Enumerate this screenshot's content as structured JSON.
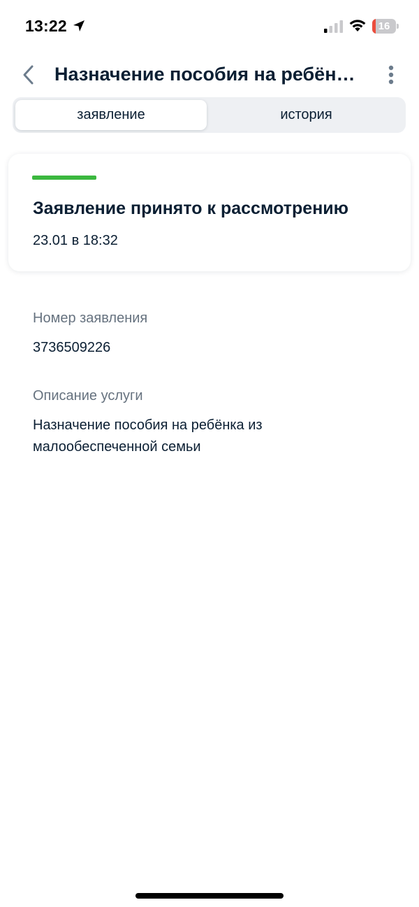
{
  "status_bar": {
    "time": "13:22",
    "battery_level": "16",
    "battery_percent": 16,
    "location_icon": "location-arrow-icon",
    "signal_icon": "cellular-signal-icon",
    "wifi_icon": "wifi-icon"
  },
  "header": {
    "title": "Назначение пособия на ребёнка из малообеспеченной семьи",
    "back_icon": "chevron-left-icon",
    "more_icon": "more-vertical-icon"
  },
  "tabs": [
    {
      "label": "заявление",
      "active": true
    },
    {
      "label": "история",
      "active": false
    }
  ],
  "status_card": {
    "title": "Заявление принято к рассмотрению",
    "date": "23.01 в 18:32",
    "status_color": "#3bb83f"
  },
  "fields": {
    "number": {
      "label": "Номер заявления",
      "value": "3736509226"
    },
    "description": {
      "label": "Описание услуги",
      "value": "Назначение пособия на ребёнка из малообеспеченной семьи"
    }
  },
  "colors": {
    "accent_text": "#0b1f33",
    "muted_text": "#66727f",
    "status_green": "#3bb83f",
    "battery_red": "#eb4d3d"
  }
}
